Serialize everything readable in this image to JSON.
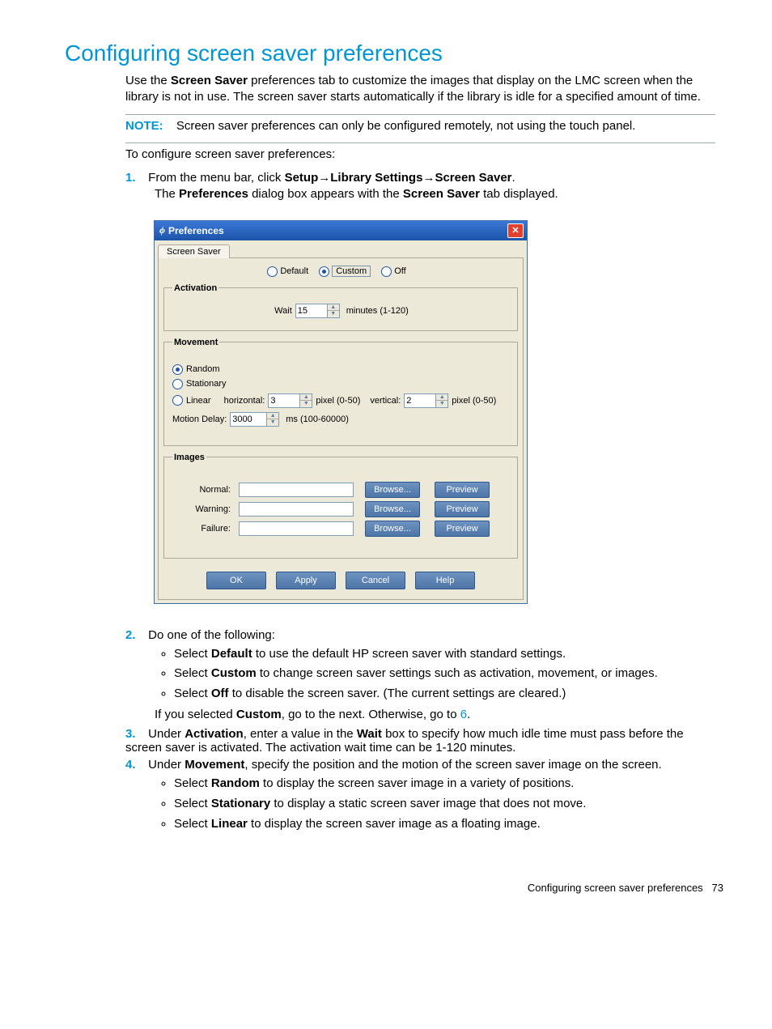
{
  "title": "Configuring screen saver preferences",
  "intro_a": "Use the ",
  "intro_bold": "Screen Saver",
  "intro_b": " preferences tab to customize the images that display on the LMC screen when the library is not in use. The screen saver starts automatically if the library is idle for a specified amount of time.",
  "note_label": "NOTE:",
  "note_text": "Screen saver preferences can only be configured remotely, not using the touch panel.",
  "pre_steps": "To configure screen saver preferences:",
  "step1_a": "From the menu bar, click ",
  "step1_setup": "Setup",
  "step1_lib": "Library Settings",
  "step1_ss": "Screen Saver",
  "step1_period": ".",
  "step1_sub_a": "The ",
  "step1_sub_pref": "Preferences",
  "step1_sub_mid": " dialog box appears with the ",
  "step1_sub_ss": "Screen Saver",
  "step1_sub_end": " tab displayed.",
  "dlg": {
    "title": "Preferences",
    "tab": "Screen Saver",
    "mode_default": "Default",
    "mode_custom": "Custom",
    "mode_off": "Off",
    "activation_legend": "Activation",
    "wait_label": "Wait",
    "wait_value": "15",
    "wait_after": "minutes (1-120)",
    "movement_legend": "Movement",
    "mv_random": "Random",
    "mv_stationary": "Stationary",
    "mv_linear": "Linear",
    "mv_horiz_label": "horizontal:",
    "mv_horiz_val": "3",
    "mv_pixel_a": "pixel (0-50)",
    "mv_vert_label": "vertical:",
    "mv_vert_val": "2",
    "mv_pixel_b": "pixel (0-50)",
    "mv_delay_label": "Motion Delay:",
    "mv_delay_val": "3000",
    "mv_delay_after": "ms (100-60000)",
    "images_legend": "Images",
    "img_normal": "Normal:",
    "img_warning": "Warning:",
    "img_failure": "Failure:",
    "browse": "Browse...",
    "preview": "Preview",
    "ok": "OK",
    "apply": "Apply",
    "cancel": "Cancel",
    "help": "Help"
  },
  "step2": "Do one of the following:",
  "s2_a1": "Select ",
  "s2_a2": "Default",
  "s2_a3": " to use the default HP screen saver with standard settings.",
  "s2_b1": "Select ",
  "s2_b2": "Custom",
  "s2_b3": " to change screen saver settings such as activation, movement, or images.",
  "s2_c1": "Select ",
  "s2_c2": "Off",
  "s2_c3": " to disable the screen saver. (The current settings are cleared.)",
  "s2_after1": "If you selected ",
  "s2_after2": "Custom",
  "s2_after3": ", go to the next. Otherwise, go to ",
  "s2_link": "6",
  "s2_after4": ".",
  "step3_a": "Under ",
  "step3_b": "Activation",
  "step3_c": ", enter a value in the ",
  "step3_d": "Wait",
  "step3_e": " box to specify how much idle time must pass before the screen saver is activated. The activation wait time can be 1-120 minutes.",
  "step4_a": "Under ",
  "step4_b": "Movement",
  "step4_c": ", specify the position and the motion of the screen saver image on the screen.",
  "s4_a1": "Select ",
  "s4_a2": "Random",
  "s4_a3": " to display the screen saver image in a variety of positions.",
  "s4_b1": "Select ",
  "s4_b2": "Stationary",
  "s4_b3": " to display a static screen saver image that does not move.",
  "s4_c1": "Select ",
  "s4_c2": "Linear",
  "s4_c3": " to display the screen saver image as a floating image.",
  "footer_text": "Configuring screen saver preferences",
  "footer_page": "73"
}
